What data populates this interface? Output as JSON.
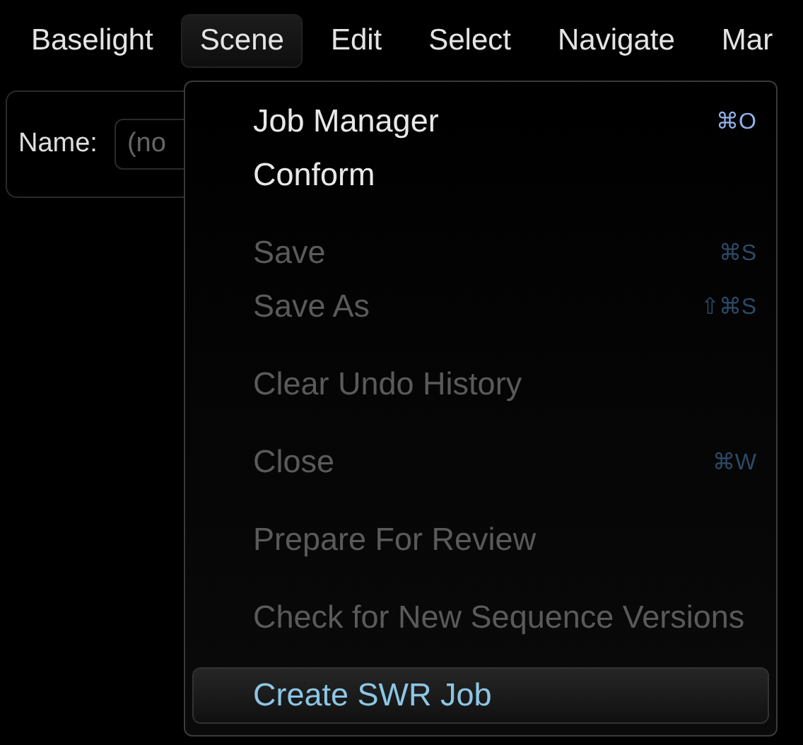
{
  "menu_bar": [
    {
      "label": "Baselight",
      "selected": false
    },
    {
      "label": "Scene",
      "selected": true
    },
    {
      "label": "Edit",
      "selected": false
    },
    {
      "label": "Select",
      "selected": false
    },
    {
      "label": "Navigate",
      "selected": false
    },
    {
      "label": "Mar",
      "selected": false
    }
  ],
  "name_field": {
    "label": "Name:",
    "placeholder": "(no"
  },
  "scene_menu": [
    {
      "items": [
        {
          "label": "Job Manager",
          "shortcut": "⌘O",
          "disabled": false,
          "highlighted": false
        },
        {
          "label": "Conform",
          "disabled": false,
          "highlighted": false
        }
      ]
    },
    {
      "items": [
        {
          "label": "Save",
          "shortcut": "⌘S",
          "disabled": true,
          "highlighted": false
        },
        {
          "label": "Save As",
          "shortcut": "⇧⌘S",
          "disabled": true,
          "highlighted": false
        }
      ]
    },
    {
      "items": [
        {
          "label": "Clear Undo History",
          "disabled": true,
          "highlighted": false
        }
      ]
    },
    {
      "items": [
        {
          "label": "Close",
          "shortcut": "⌘W",
          "disabled": true,
          "highlighted": false
        }
      ]
    },
    {
      "items": [
        {
          "label": "Prepare For Review",
          "disabled": true,
          "highlighted": false
        }
      ]
    },
    {
      "items": [
        {
          "label": "Check for New Sequence Versions",
          "disabled": true,
          "highlighted": false
        }
      ]
    },
    {
      "items": [
        {
          "label": "Create SWR Job",
          "disabled": false,
          "highlighted": true
        }
      ]
    }
  ]
}
